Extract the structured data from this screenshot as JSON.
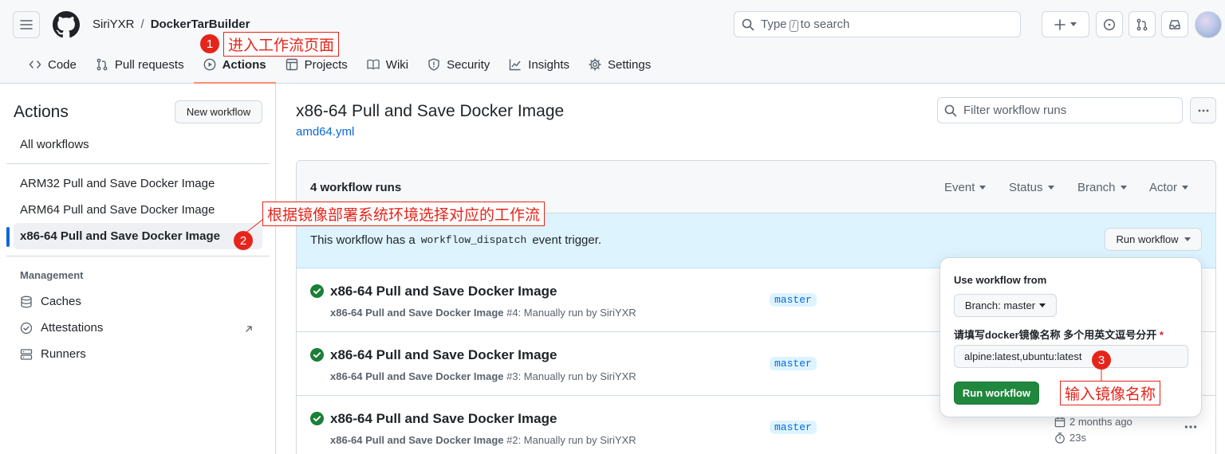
{
  "header": {
    "owner": "SiriYXR",
    "separator": "/",
    "repo": "DockerTarBuilder",
    "search_prefix": "Type",
    "search_key": "/",
    "search_suffix": "to search"
  },
  "tabs": [
    {
      "label": "Code",
      "icon": "code-icon"
    },
    {
      "label": "Pull requests",
      "icon": "pull-request-icon"
    },
    {
      "label": "Actions",
      "icon": "play-icon",
      "active": true
    },
    {
      "label": "Projects",
      "icon": "table-icon"
    },
    {
      "label": "Wiki",
      "icon": "book-icon"
    },
    {
      "label": "Security",
      "icon": "shield-icon"
    },
    {
      "label": "Insights",
      "icon": "graph-icon"
    },
    {
      "label": "Settings",
      "icon": "gear-icon"
    }
  ],
  "sidebar": {
    "title": "Actions",
    "new_workflow": "New workflow",
    "all_workflows": "All workflows",
    "workflows": [
      "ARM32 Pull and Save Docker Image",
      "ARM64 Pull and Save Docker Image",
      "x86-64 Pull and Save Docker Image"
    ],
    "management_heading": "Management",
    "management_items": [
      {
        "label": "Caches",
        "icon": "database-icon"
      },
      {
        "label": "Attestations",
        "icon": "verified-icon"
      },
      {
        "label": "Runners",
        "icon": "server-icon"
      }
    ]
  },
  "main": {
    "title": "x86-64 Pull and Save Docker Image",
    "file": "amd64.yml",
    "filter_placeholder": "Filter workflow runs",
    "runs_count": "4 workflow runs",
    "filters": [
      "Event",
      "Status",
      "Branch",
      "Actor"
    ],
    "dispatch_prefix": "This workflow has a",
    "dispatch_code": "workflow_dispatch",
    "dispatch_suffix": "event trigger.",
    "run_workflow_button": "Run workflow",
    "runs": [
      {
        "title": "x86-64 Pull and Save Docker Image",
        "workflow": "x86-64 Pull and Save Docker Image",
        "detail": "#4: Manually run by SiriYXR",
        "branch": "master"
      },
      {
        "title": "x86-64 Pull and Save Docker Image",
        "workflow": "x86-64 Pull and Save Docker Image",
        "detail": "#3: Manually run by SiriYXR",
        "branch": "master"
      },
      {
        "title": "x86-64 Pull and Save Docker Image",
        "workflow": "x86-64 Pull and Save Docker Image",
        "detail": "#2: Manually run by SiriYXR",
        "branch": "master",
        "date": "2 months ago",
        "duration": "23s"
      }
    ]
  },
  "popover": {
    "use_from": "Use workflow from",
    "branch": "Branch: master",
    "field_label": "请填写docker镜像名称 多个用英文逗号分开",
    "required": "*",
    "field_value": "alpine:latest,ubuntu:latest",
    "run_button": "Run workflow"
  },
  "annotations": [
    {
      "num": "1",
      "text": "进入工作流页面"
    },
    {
      "num": "2",
      "text": "根据镜像部署系统环境选择对应的工作流"
    },
    {
      "num": "3",
      "text": "输入镜像名称"
    }
  ],
  "colors": {
    "accent": "#0969da",
    "success": "#1a7f37",
    "button_green": "#1f883d",
    "annotation": "#e5251b",
    "tab_underline": "#fd8c73"
  }
}
